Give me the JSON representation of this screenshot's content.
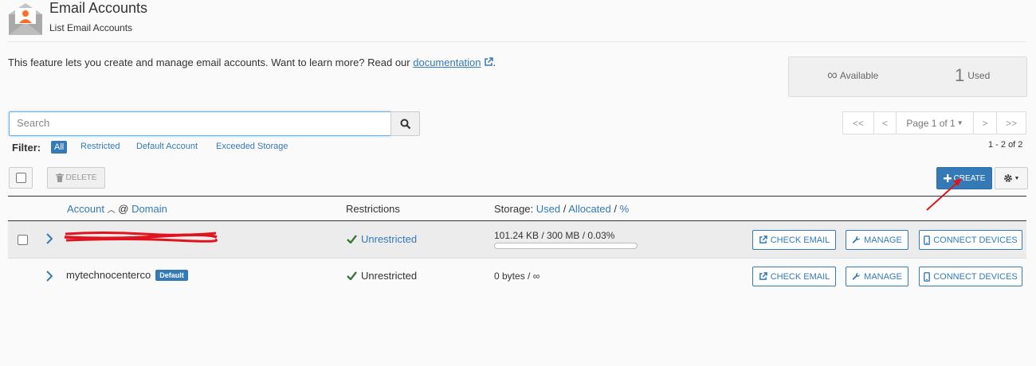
{
  "header": {
    "title": "Email Accounts",
    "subtitle": "List Email Accounts"
  },
  "intro": {
    "text": "This feature lets you create and manage email accounts. Want to learn more? Read our ",
    "link": "documentation",
    "tail": "."
  },
  "stats": {
    "available_value": "∞",
    "available_label": "Available",
    "used_value": "1",
    "used_label": "Used"
  },
  "search": {
    "placeholder": "Search"
  },
  "filter": {
    "label": "Filter:",
    "options": [
      "All",
      "Restricted",
      "Default Account",
      "Exceeded Storage"
    ],
    "selected": "All"
  },
  "pagination": {
    "first": "<<",
    "prev": "<",
    "page": "Page 1 of 1",
    "next": ">",
    "last": ">>",
    "range": "1 - 2 of 2"
  },
  "toolbar": {
    "delete_label": "DELETE",
    "create_label": "CREATE"
  },
  "table": {
    "col_account": "Account",
    "col_at": "@",
    "col_domain": "Domain",
    "col_restrictions": "Restrictions",
    "col_storage_prefix": "Storage:",
    "col_storage_used": "Used",
    "col_storage_allocated": "Allocated",
    "col_storage_pct": "%",
    "rows": [
      {
        "account": "",
        "default_badge": "",
        "restriction": "Unrestricted",
        "storage": "101.24 KB / 300 MB / 0.03%",
        "usage_fraction": 0.0003
      },
      {
        "account": "mytechnocenterco",
        "default_badge": "Default",
        "restriction": "Unrestricted",
        "storage": "0 bytes / ∞"
      }
    ],
    "actions": {
      "check_email": "CHECK EMAIL",
      "manage": "MANAGE",
      "connect_devices": "CONNECT DEVICES"
    }
  },
  "colors": {
    "primary": "#337ab7",
    "success": "#3c763d",
    "annotation": "#e0141e"
  }
}
